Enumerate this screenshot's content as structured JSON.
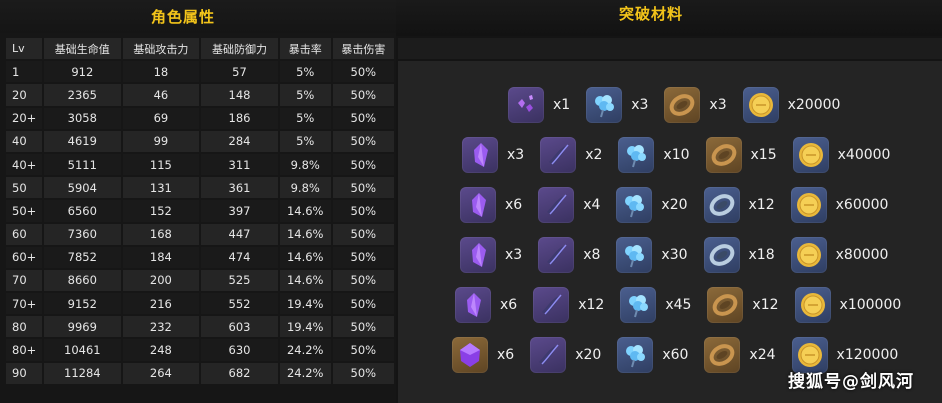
{
  "left": {
    "title": "角色属性",
    "columns": [
      "Lv",
      "基础生命值",
      "基础攻击力",
      "基础防御力",
      "暴击率",
      "暴击伤害"
    ],
    "rows": [
      [
        "1",
        "912",
        "18",
        "57",
        "5%",
        "50%"
      ],
      [
        "20",
        "2365",
        "46",
        "148",
        "5%",
        "50%"
      ],
      [
        "20+",
        "3058",
        "69",
        "186",
        "5%",
        "50%"
      ],
      [
        "40",
        "4619",
        "99",
        "284",
        "5%",
        "50%"
      ],
      [
        "40+",
        "5111",
        "115",
        "311",
        "9.8%",
        "50%"
      ],
      [
        "50",
        "5904",
        "131",
        "361",
        "9.8%",
        "50%"
      ],
      [
        "50+",
        "6560",
        "152",
        "397",
        "14.6%",
        "50%"
      ],
      [
        "60",
        "7360",
        "168",
        "447",
        "14.6%",
        "50%"
      ],
      [
        "60+",
        "7852",
        "184",
        "474",
        "14.6%",
        "50%"
      ],
      [
        "70",
        "8660",
        "200",
        "525",
        "14.6%",
        "50%"
      ],
      [
        "70+",
        "9152",
        "216",
        "552",
        "19.4%",
        "50%"
      ],
      [
        "80",
        "9969",
        "232",
        "603",
        "19.4%",
        "50%"
      ],
      [
        "80+",
        "10461",
        "248",
        "630",
        "24.2%",
        "50%"
      ],
      [
        "90",
        "11284",
        "264",
        "682",
        "24.2%",
        "50%"
      ]
    ]
  },
  "right": {
    "title": "突破材料",
    "rows": [
      [
        {
          "icon": "small-gem-fragments-icon",
          "tile": "purple",
          "qty": "x1"
        },
        {
          "icon": "blue-flower-icon",
          "tile": "blue",
          "qty": "x3"
        },
        {
          "icon": "bronze-relic-ring-icon",
          "tile": "gold",
          "qty": "x3"
        },
        {
          "icon": "gold-coin-icon",
          "tile": "blue",
          "qty": "x20000"
        }
      ],
      [
        {
          "icon": "purple-crystal-icon",
          "tile": "purple",
          "qty": "x3"
        },
        {
          "icon": "purple-feather-icon",
          "tile": "purple",
          "qty": "x2"
        },
        {
          "icon": "blue-flower-icon",
          "tile": "blue",
          "qty": "x10"
        },
        {
          "icon": "bronze-relic-ring-icon",
          "tile": "gold",
          "qty": "x15"
        },
        {
          "icon": "gold-coin-icon",
          "tile": "blue",
          "qty": "x40000"
        }
      ],
      [
        {
          "icon": "purple-crystal-icon",
          "tile": "purple",
          "qty": "x6"
        },
        {
          "icon": "purple-feather-icon",
          "tile": "purple",
          "qty": "x4"
        },
        {
          "icon": "blue-flower-icon",
          "tile": "blue",
          "qty": "x20"
        },
        {
          "icon": "silver-relic-ring-icon",
          "tile": "blue",
          "qty": "x12"
        },
        {
          "icon": "gold-coin-icon",
          "tile": "blue",
          "qty": "x60000"
        }
      ],
      [
        {
          "icon": "purple-crystal-icon",
          "tile": "purple",
          "qty": "x3"
        },
        {
          "icon": "purple-feather-icon",
          "tile": "purple",
          "qty": "x8"
        },
        {
          "icon": "blue-flower-icon",
          "tile": "blue",
          "qty": "x30"
        },
        {
          "icon": "silver-relic-ring-icon",
          "tile": "blue",
          "qty": "x18"
        },
        {
          "icon": "gold-coin-icon",
          "tile": "blue",
          "qty": "x80000"
        }
      ],
      [
        {
          "icon": "purple-crystal-icon",
          "tile": "purple",
          "qty": "x6"
        },
        {
          "icon": "purple-feather-icon",
          "tile": "purple",
          "qty": "x12"
        },
        {
          "icon": "blue-flower-icon",
          "tile": "blue",
          "qty": "x45"
        },
        {
          "icon": "bronze-relic-ring-icon",
          "tile": "gold",
          "qty": "x12"
        },
        {
          "icon": "gold-coin-icon",
          "tile": "blue",
          "qty": "x100000"
        }
      ],
      [
        {
          "icon": "purple-gem-icon",
          "tile": "gold",
          "qty": "x6"
        },
        {
          "icon": "purple-feather-icon",
          "tile": "purple",
          "qty": "x20"
        },
        {
          "icon": "blue-flower-icon",
          "tile": "blue",
          "qty": "x60"
        },
        {
          "icon": "bronze-relic-ring-icon",
          "tile": "gold",
          "qty": "x24"
        },
        {
          "icon": "gold-coin-icon",
          "tile": "blue",
          "qty": "x120000"
        }
      ]
    ]
  },
  "watermark": "搜狐号@剑风河",
  "colors": {
    "title": "#f3c41a",
    "background": "#141414",
    "panel": "#242424"
  }
}
